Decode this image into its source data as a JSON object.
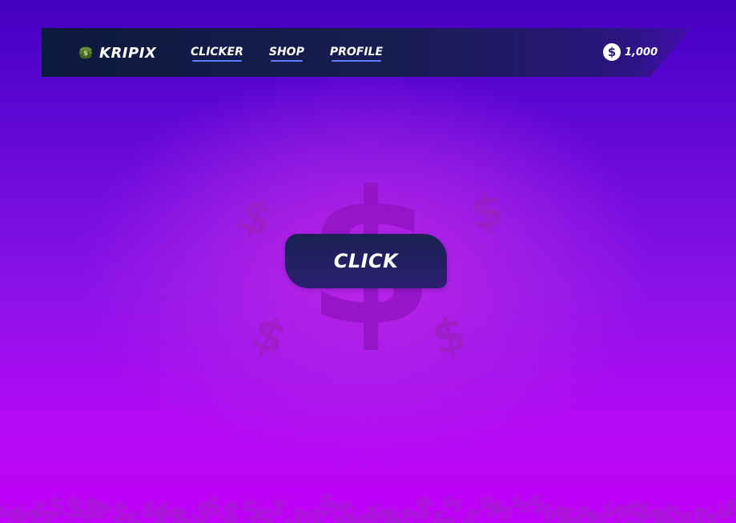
{
  "header": {
    "brand": {
      "name": "KRIPIX",
      "icon": "money-stack-icon"
    },
    "nav": [
      {
        "label": "CLICKER"
      },
      {
        "label": "SHOP"
      },
      {
        "label": "PROFILE"
      }
    ],
    "balance": {
      "icon": "dollar-coin-icon",
      "symbol": "$",
      "value": "1,000"
    }
  },
  "main": {
    "click_button_label": "CLICK",
    "decor_icon": "dollar-sign-icon"
  },
  "colors": {
    "background_top": "#4400c0",
    "background_bottom": "#c000f8",
    "navbar": "#0c1a3c",
    "button": "#1a2152",
    "underline": "#5f7cff"
  }
}
